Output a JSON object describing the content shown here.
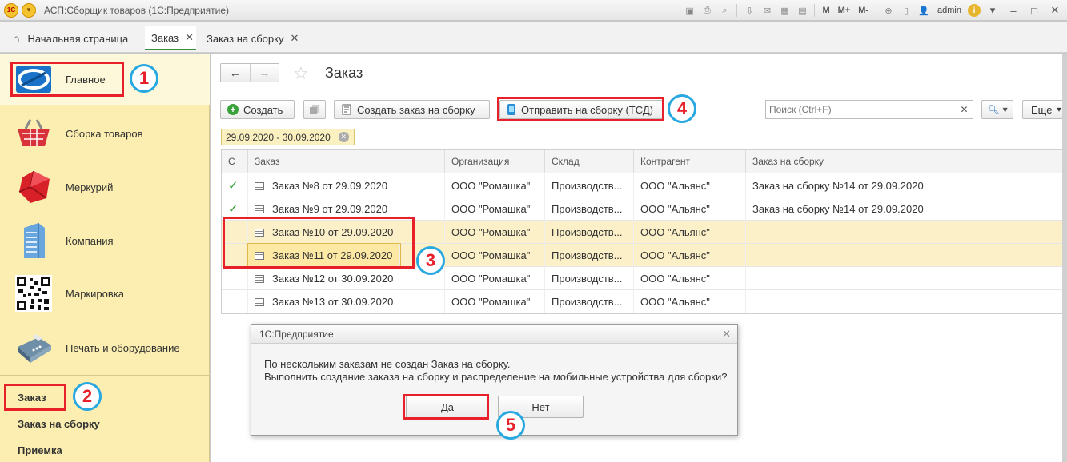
{
  "titlebar": {
    "app_title": "АСП:Сборщик товаров  (1С:Предприятие)",
    "user": "admin",
    "m1": "M",
    "m2": "M+",
    "m3": "M-"
  },
  "tabs": [
    {
      "label": "Начальная страница"
    },
    {
      "label": "Заказ"
    },
    {
      "label": "Заказ на сборку"
    }
  ],
  "sidebar": {
    "items": [
      {
        "label": "Главное",
        "icon": "globe-icon"
      },
      {
        "label": "Сборка товаров",
        "icon": "basket-icon"
      },
      {
        "label": "Меркурий",
        "icon": "cube-icon"
      },
      {
        "label": "Компания",
        "icon": "building-icon"
      },
      {
        "label": "Маркировка",
        "icon": "qr-code-icon"
      },
      {
        "label": "Печать и оборудование",
        "icon": "printer-icon"
      }
    ],
    "sub_items": [
      {
        "label": "Заказ"
      },
      {
        "label": "Заказ на сборку"
      },
      {
        "label": "Приемка"
      }
    ]
  },
  "form": {
    "title": "Заказ",
    "create_label": "Создать",
    "create_assembly_label": "Создать заказ на сборку",
    "send_label": "Отправить на сборку (ТСД)",
    "search_placeholder": "Поиск (Ctrl+F)",
    "more_label": "Еще",
    "period": "29.09.2020 - 30.09.2020"
  },
  "table": {
    "columns": [
      "С",
      "Заказ",
      "Организация",
      "Склад",
      "Контрагент",
      "Заказ на сборку"
    ],
    "rows": [
      {
        "status": "✓",
        "order": "Заказ №8 от 29.09.2020",
        "org": "ООО \"Ромашка\"",
        "warehouse": "Производств...",
        "counterparty": "ООО \"Альянс\"",
        "assembly": "Заказ на сборку №14 от 29.09.2020"
      },
      {
        "status": "✓",
        "order": "Заказ №9 от 29.09.2020",
        "org": "ООО \"Ромашка\"",
        "warehouse": "Производств...",
        "counterparty": "ООО \"Альянс\"",
        "assembly": "Заказ на сборку №14 от 29.09.2020"
      },
      {
        "status": "",
        "order": "Заказ №10 от 29.09.2020",
        "org": "ООО \"Ромашка\"",
        "warehouse": "Производств...",
        "counterparty": "ООО \"Альянс\"",
        "assembly": ""
      },
      {
        "status": "",
        "order": "Заказ №11 от 29.09.2020",
        "org": "ООО \"Ромашка\"",
        "warehouse": "Производств...",
        "counterparty": "ООО \"Альянс\"",
        "assembly": ""
      },
      {
        "status": "",
        "order": "Заказ №12 от 30.09.2020",
        "org": "ООО \"Ромашка\"",
        "warehouse": "Производств...",
        "counterparty": "ООО \"Альянс\"",
        "assembly": ""
      },
      {
        "status": "",
        "order": "Заказ №13 от 30.09.2020",
        "org": "ООО \"Ромашка\"",
        "warehouse": "Производств...",
        "counterparty": "ООО \"Альянс\"",
        "assembly": ""
      }
    ]
  },
  "dialog": {
    "title": "1С:Предприятие",
    "line1": "По нескольким заказам не создан Заказ на сборку.",
    "line2": "Выполнить создание заказа на сборку и распределение на мобильные устройства для сборки?",
    "yes": "Да",
    "no": "Нет"
  },
  "annotations": [
    "1",
    "2",
    "3",
    "4",
    "5"
  ],
  "colors": {
    "annotation_box": "#e8202a",
    "annotation_circle": "#28a8e0",
    "sidebar_bg": "#fbeeb0",
    "selected_row": "#fbf0c7"
  }
}
